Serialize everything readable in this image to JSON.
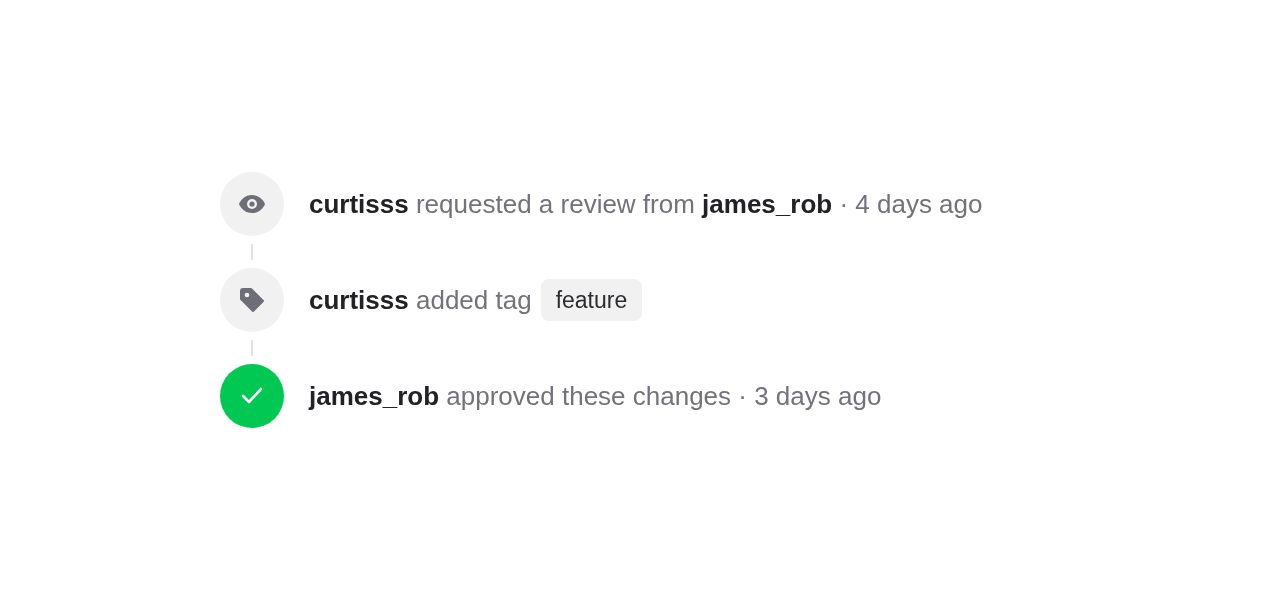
{
  "timeline": [
    {
      "kind": "review",
      "text": "**curtisss** requested a review from **james_rob** · 4 days ago"
    },
    {
      "kind": "tag",
      "text": "**curtisss** added tag",
      "tag": "feature"
    },
    {
      "kind": "approved",
      "text": "**james_rob** approved these changes · 3 days ago"
    }
  ]
}
